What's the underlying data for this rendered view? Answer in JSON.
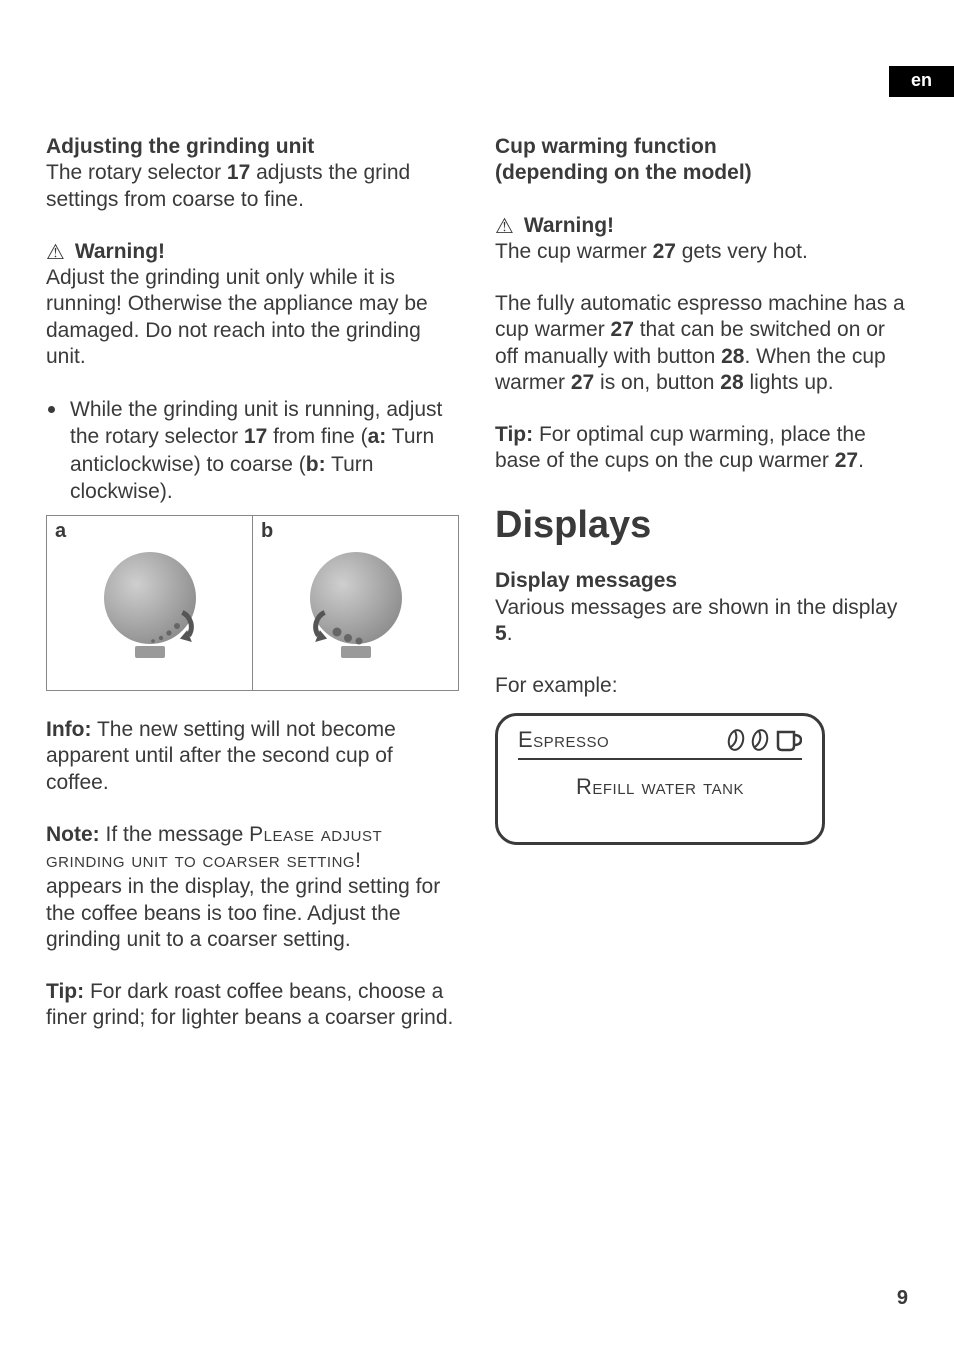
{
  "lang_tab": "en",
  "page_number": "9",
  "left": {
    "h1": "Adjusting the grinding unit",
    "intro_a": "The rotary selector ",
    "intro_b_bold": "17",
    "intro_c": " adjusts the grind settings from coarse to fine.",
    "warn_label": "Warning!",
    "warn_body": "Adjust the grinding unit only while it is running! Otherwise the appliance may be damaged. Do not reach into the grinding unit.",
    "bullet_a": "While the grinding unit is running, adjust the rotary selector ",
    "bullet_b_bold": "17",
    "bullet_c": " from fine (",
    "bullet_d_bold": "a:",
    "bullet_e": " Turn anticlockwise) to coarse (",
    "bullet_f_bold": "b:",
    "bullet_g": " Turn clockwise).",
    "fig_a": "a",
    "fig_b": "b",
    "info_label": "Info:",
    "info_body": " The new setting will not become apparent until after the second cup of coffee.",
    "note_label": "Note:",
    "note_a": " If the message ",
    "note_msg_line1": "Please adjust",
    "note_msg_line2": "grinding unit to coarser setting!",
    "note_b": " appears in the display, the grind setting for the coffee beans is too fine. Adjust the grinding unit to a coarser setting.",
    "tip_label": "Tip:",
    "tip_body": " For dark roast coffee beans, choose a finer grind; for lighter beans a coarser grind."
  },
  "right": {
    "h1_line1": "Cup warming function",
    "h1_line2": "(depending on the model)",
    "warn_label": "Warning!",
    "warn_a": "The cup warmer ",
    "warn_b_bold": "27",
    "warn_c": " gets very hot.",
    "p1_a": "The fully automatic espresso machine has a cup warmer ",
    "p1_b_bold": "27",
    "p1_c": " that can be switched on or off manually with button ",
    "p1_d_bold": "28",
    "p1_e": ". When the cup warmer ",
    "p1_f_bold": "27",
    "p1_g": " is on, button ",
    "p1_h_bold": "28",
    "p1_i": " lights up.",
    "tip_label": "Tip:",
    "tip_a": " For optimal cup warming, place the base of the cups on the cup warmer ",
    "tip_b_bold": "27",
    "tip_c": ".",
    "h2": "Displays",
    "dm_label": "Display messages",
    "dm_a": "Various messages are shown in the display ",
    "dm_b_bold": "5",
    "dm_c": ".",
    "for_example": "For example:",
    "lcd_title": "Espresso",
    "lcd_msg": "Refill water tank"
  }
}
